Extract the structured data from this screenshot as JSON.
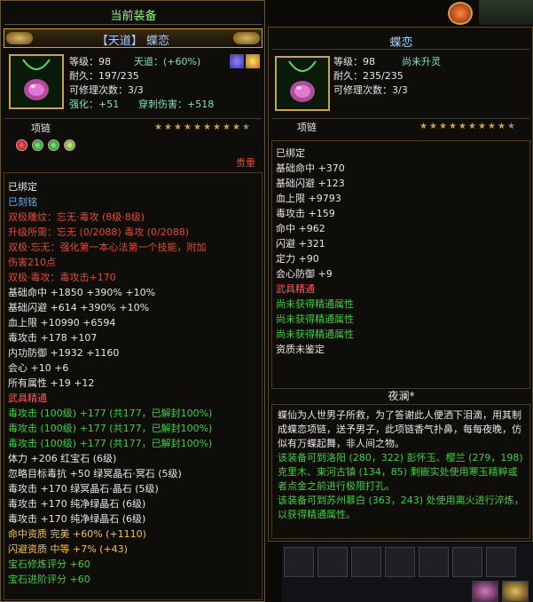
{
  "left": {
    "panel_title": "当前装备",
    "item_name": "【天道】 蝶恋",
    "level": "等级：98",
    "tiandao": "天道：(+60%)",
    "durability": "耐久：197/235",
    "repairs": "可修理次数：3/3",
    "strengthen": "强化：+51",
    "pierce": "穿刺伤害：+518",
    "slot": "项链",
    "stars_filled": 9,
    "stars_total": 10,
    "precious": "贵重",
    "lines": [
      {
        "t": "已绑定",
        "c": "w"
      },
      {
        "t": "已刻铭",
        "c": "b"
      },
      {
        "t": "双极雕纹：忘无·毒攻 (8级·8级)",
        "c": "r"
      },
      {
        "t": "升级所需：忘无 (0/2088)   毒攻 (0/2088)",
        "c": "r"
      },
      {
        "t": "双极·忘无：强化第一本心法第一个技能，附加",
        "c": "r"
      },
      {
        "t": "伤害210点",
        "c": "r"
      },
      {
        "t": "双极·毒攻：毒攻击+170",
        "c": "r"
      },
      {
        "t": "基础命中 +1850 +390% +10%",
        "c": "w"
      },
      {
        "t": "基础闪避 +614 +390% +10%",
        "c": "w"
      },
      {
        "t": "血上限 +10990 +6594",
        "c": "w"
      },
      {
        "t": "毒攻击 +178 +107",
        "c": "w"
      },
      {
        "t": "内功防御 +1932 +1160",
        "c": "w"
      },
      {
        "t": "会心 +10 +6",
        "c": "w"
      },
      {
        "t": "所有属性 +19 +12",
        "c": "w"
      },
      {
        "t": "武具精通",
        "c": "pk"
      },
      {
        "t": "毒攻击 (100级) +177 (共177，已解封100%)",
        "c": "g"
      },
      {
        "t": "毒攻击 (100级) +177 (共177，已解封100%)",
        "c": "g"
      },
      {
        "t": "毒攻击 (100级) +177 (共177，已解封100%)",
        "c": "g"
      },
      {
        "t": "体力 +206 红宝石 (6级)",
        "c": "w"
      },
      {
        "t": "忽略目标毒抗 +50 绿冥晶石·冥石 (5级)",
        "c": "w"
      },
      {
        "t": "毒攻击 +170 绿冥晶石·晶石 (5级)",
        "c": "w"
      },
      {
        "t": "毒攻击 +170 纯净绿晶石 (6级)",
        "c": "w"
      },
      {
        "t": "毒攻击 +170 纯净绿晶石 (6级)",
        "c": "w"
      },
      {
        "t": "命中资质   完美 +60% (+1110)",
        "c": "y"
      },
      {
        "t": "闪避资质   中等 +7% (+43)",
        "c": "y"
      },
      {
        "t": "宝石修炼评分 +60",
        "c": "g"
      },
      {
        "t": "宝石进阶评分 +60",
        "c": "g"
      }
    ]
  },
  "right": {
    "item_name": "蝶恋",
    "level": "等级：98",
    "status": "尚未升灵",
    "durability": "耐久：235/235",
    "repairs": "可修理次数：3/3",
    "slot": "项链",
    "stars_filled": 9,
    "stars_total": 10,
    "lines": [
      {
        "t": "已绑定",
        "c": "w"
      },
      {
        "t": "基础命中 +370",
        "c": "w"
      },
      {
        "t": "基础闪避 +123",
        "c": "w"
      },
      {
        "t": "血上限 +9793",
        "c": "w"
      },
      {
        "t": "毒攻击 +159",
        "c": "w"
      },
      {
        "t": "命中 +962",
        "c": "w"
      },
      {
        "t": "闪避 +321",
        "c": "w"
      },
      {
        "t": "定力 +90",
        "c": "w"
      },
      {
        "t": "会心防御 +9",
        "c": "w"
      },
      {
        "t": "武具精通",
        "c": "pk"
      },
      {
        "t": "尚未获得精通属性",
        "c": "g"
      },
      {
        "t": "尚未获得精通属性",
        "c": "g"
      },
      {
        "t": "尚未获得精通属性",
        "c": "g"
      },
      {
        "t": "资质未鉴定",
        "c": "w"
      }
    ],
    "desc_title": "夜澜*",
    "desc_text": "蝶仙为人世男子所救，为了答谢此人便洒下泪滴，用其制成蝶恋项链，送予男子，此项链香气扑鼻，每每夜晚，仿似有万蝶起舞，非人间之物。",
    "loc_1": "该装备可到洛阳 (280，322) 彭怀玉、樱兰 (279，198) 克里木、柬河古镇 (134，85) 剩嵌实处使用寒玉精粹或者点金之前进行极限打孔。",
    "loc_2": "该装备可到苏州慕白 (363，243) 处使用离火进行淬炼，以获得精通属性。"
  },
  "colors": {
    "white": "#e6e6e6",
    "blue": "#5ab4ff",
    "red": "#e34a32",
    "green": "#3dd13d",
    "yellow": "#f6c343",
    "gold": "#c9a24a"
  }
}
